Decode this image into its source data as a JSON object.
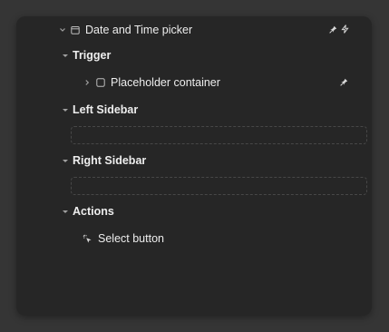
{
  "tree": {
    "root": {
      "label": "Date and Time picker"
    },
    "trigger": {
      "label": "Trigger",
      "child": {
        "label": "Placeholder container"
      }
    },
    "left_sidebar": {
      "label": "Left Sidebar"
    },
    "right_sidebar": {
      "label": "Right Sidebar"
    },
    "actions": {
      "label": "Actions",
      "child": {
        "label": "Select button"
      }
    }
  },
  "icons": {
    "root_expand": "chevron-down-icon",
    "root_type": "calendar-icon",
    "root_pin": "pin-icon",
    "root_flash": "bolt-icon",
    "placeholder_expand": "chevron-right-icon",
    "placeholder_type": "square-icon",
    "placeholder_pin": "pin-icon",
    "select_type": "cursor-click-icon"
  },
  "colors": {
    "background": "#353535",
    "panel": "#262626",
    "text": "#ededed",
    "muted": "#a0a0a0"
  }
}
